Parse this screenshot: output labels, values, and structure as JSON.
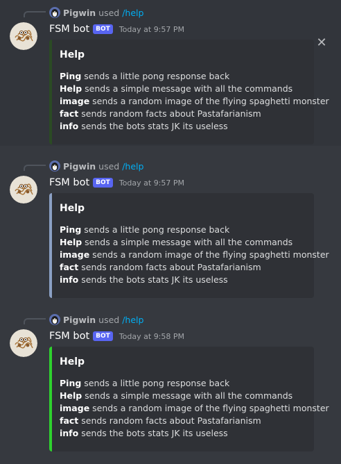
{
  "messages": [
    {
      "reply": {
        "user": "Pigwin",
        "used": "used",
        "command": "/help"
      },
      "author": "FSM bot",
      "bot_tag": "BOT",
      "timestamp": "Today at 9:57 PM",
      "embed": {
        "color": "#2b4a24",
        "title": "Help",
        "lines": [
          {
            "cmd": "Ping",
            "text": " sends a little pong response back"
          },
          {
            "cmd": "Help",
            "text": " sends a simple message with all the commands"
          },
          {
            "cmd": "image",
            "text": " sends a random image of the flying spaghetti monster"
          },
          {
            "cmd": "fact",
            "text": " sends random facts about Pastafarianism"
          },
          {
            "cmd": "info",
            "text": " sends the bots stats JK its useless"
          }
        ]
      },
      "close_icon": "close-icon"
    },
    {
      "reply": {
        "user": "Pigwin",
        "used": "used",
        "command": "/help"
      },
      "author": "FSM bot",
      "bot_tag": "BOT",
      "timestamp": "Today at 9:57 PM",
      "embed": {
        "color": "#8ba0c4",
        "title": "Help",
        "lines": [
          {
            "cmd": "Ping",
            "text": " sends a little pong response back"
          },
          {
            "cmd": "Help",
            "text": " sends a simple message with all the commands"
          },
          {
            "cmd": "image",
            "text": " sends a random image of the flying spaghetti monster"
          },
          {
            "cmd": "fact",
            "text": " sends random facts about Pastafarianism"
          },
          {
            "cmd": "info",
            "text": " sends the bots stats JK its useless"
          }
        ]
      }
    },
    {
      "reply": {
        "user": "Pigwin",
        "used": "used",
        "command": "/help"
      },
      "author": "FSM bot",
      "bot_tag": "BOT",
      "timestamp": "Today at 9:58 PM",
      "embed": {
        "color": "#2ed12e",
        "title": "Help",
        "lines": [
          {
            "cmd": "Ping",
            "text": " sends a little pong response back"
          },
          {
            "cmd": "Help",
            "text": " sends a simple message with all the commands"
          },
          {
            "cmd": "image",
            "text": " sends a random image of the flying spaghetti monster"
          },
          {
            "cmd": "fact",
            "text": " sends random facts about Pastafarianism"
          },
          {
            "cmd": "info",
            "text": " sends the bots stats JK its useless"
          }
        ]
      }
    }
  ]
}
